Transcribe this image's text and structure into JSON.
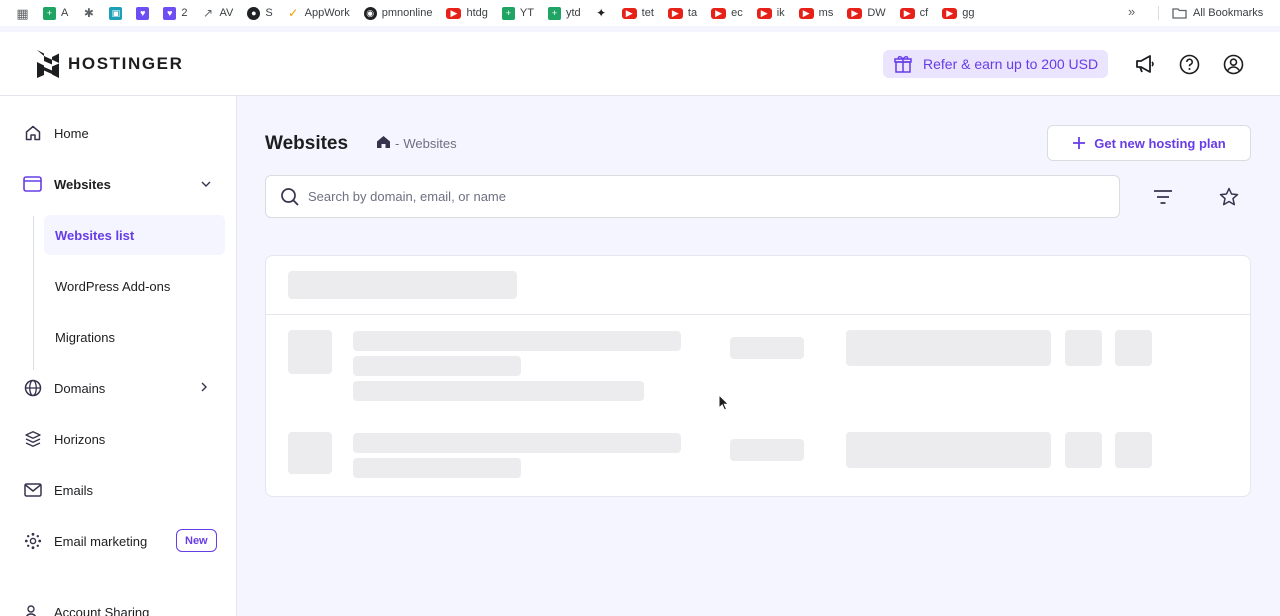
{
  "bookmarks": {
    "items": [
      {
        "label": "A",
        "icon": "sheets-icon"
      },
      {
        "label": "",
        "icon": "extension-icon"
      },
      {
        "label": "",
        "icon": "app-icon"
      },
      {
        "label": "",
        "icon": "chat-icon"
      },
      {
        "label": "2",
        "icon": "chat-icon"
      },
      {
        "label": "AV",
        "icon": "trend-icon"
      },
      {
        "label": "S",
        "icon": "globe-icon"
      },
      {
        "label": "AppWork",
        "icon": "check-icon"
      },
      {
        "label": "pmnonline",
        "icon": "github-icon"
      },
      {
        "label": "htdg",
        "icon": "youtube-icon"
      },
      {
        "label": "YT",
        "icon": "sheets-icon"
      },
      {
        "label": "ytd",
        "icon": "sheets-icon"
      },
      {
        "label": "",
        "icon": "pin-icon"
      },
      {
        "label": "tet",
        "icon": "youtube-icon"
      },
      {
        "label": "ta",
        "icon": "youtube-icon"
      },
      {
        "label": "ec",
        "icon": "youtube-icon"
      },
      {
        "label": "ik",
        "icon": "youtube-icon"
      },
      {
        "label": "ms",
        "icon": "youtube-icon"
      },
      {
        "label": "DW",
        "icon": "youtube-icon"
      },
      {
        "label": "cf",
        "icon": "youtube-icon"
      },
      {
        "label": "gg",
        "icon": "youtube-icon"
      }
    ],
    "all_label": "All Bookmarks"
  },
  "header": {
    "brand": "HOSTINGER",
    "refer_label": "Refer & earn up to 200 USD"
  },
  "sidebar": {
    "items": [
      {
        "label": "Home"
      },
      {
        "label": "Websites"
      },
      {
        "label": "Domains"
      },
      {
        "label": "Horizons"
      },
      {
        "label": "Emails"
      },
      {
        "label": "Email marketing",
        "badge": "New"
      },
      {
        "label": "Account Sharing"
      }
    ],
    "sub_items": [
      {
        "label": "Websites list",
        "active": true
      },
      {
        "label": "WordPress Add-ons"
      },
      {
        "label": "Migrations"
      }
    ]
  },
  "main": {
    "title": "Websites",
    "breadcrumb_sep": "-",
    "breadcrumb_current": "Websites",
    "new_plan_label": "Get new hosting plan",
    "search_placeholder": "Search by domain, email, or name",
    "loading": true
  },
  "colors": {
    "accent": "#673de6",
    "accent_soft": "#ebe4ff",
    "page_bg": "#f4f5ff",
    "skeleton": "#ececef"
  }
}
